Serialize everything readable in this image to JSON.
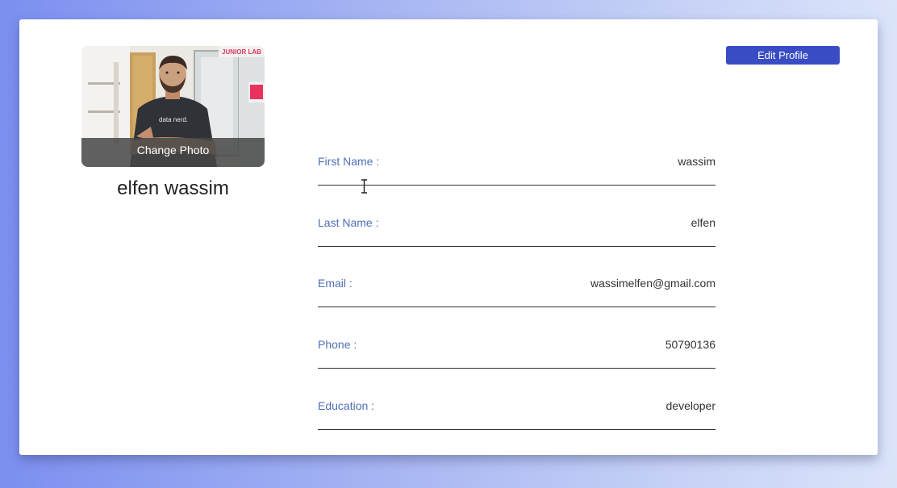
{
  "profile": {
    "photo_alt": "Profile photo",
    "change_photo_label": "Change Photo",
    "full_name": "elfen wassim"
  },
  "toolbar": {
    "edit_profile_label": "Edit Profile"
  },
  "fields": [
    {
      "label": "First Name :",
      "value": "wassim"
    },
    {
      "label": "Last Name :",
      "value": "elfen"
    },
    {
      "label": "Email :",
      "value": "wassimelfen@gmail.com"
    },
    {
      "label": "Phone :",
      "value": "50790136"
    },
    {
      "label": "Education :",
      "value": "developer"
    }
  ],
  "photo_text": {
    "sign": "JUNIOR LAB",
    "shirt": "data nerd."
  },
  "colors": {
    "accent": "#3a4cc4",
    "label": "#4f6fb8",
    "text": "#333333",
    "card": "#ffffff"
  }
}
